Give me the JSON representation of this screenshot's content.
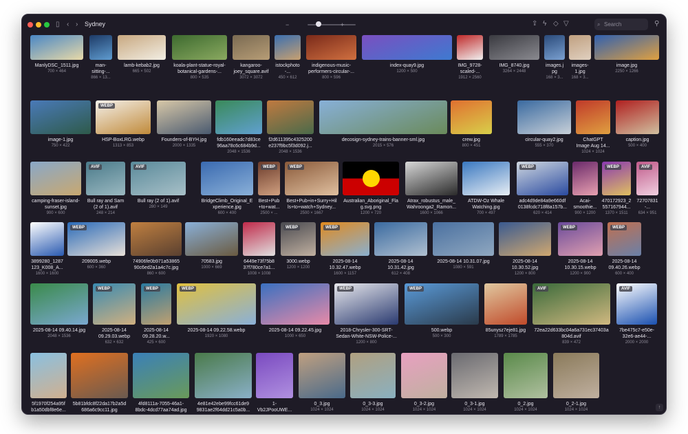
{
  "window": {
    "title": "Sydney",
    "search_placeholder": "Search",
    "slider_minus": "−",
    "slider_plus": "+"
  },
  "colors": {
    "close": "#ff5f57",
    "minimize": "#febc2e",
    "zoom": "#28c840"
  },
  "rows": [
    [
      {
        "name": "ManlyDSC_1511.jpg",
        "dims": "700 × 464",
        "badge": "",
        "colors": [
          "#4a87c5",
          "#e8d9a8"
        ]
      },
      {
        "name": "man-\nsitting-...",
        "dims": "866 × 13...",
        "badge": "",
        "colors": [
          "#1d3a66",
          "#5f9cd0"
        ]
      },
      {
        "name": "lamb-kebab2.jpg",
        "dims": "665 × 502",
        "badge": "",
        "colors": [
          "#c8a880",
          "#f2eee4"
        ]
      },
      {
        "name": "koala-plant-statue-royal-\nbotanical-gardens-...",
        "dims": "800 × 535",
        "badge": "",
        "colors": [
          "#3d6a2f",
          "#8aa960"
        ]
      },
      {
        "name": "kangaroo-\njoey_square.avif",
        "dims": "3072 × 3072",
        "badge": "",
        "colors": [
          "#7a6a52",
          "#b79d76"
        ]
      },
      {
        "name": "istockphoto\n-...",
        "dims": "450 × 612",
        "badge": "",
        "colors": [
          "#3b6fb0",
          "#c8a070"
        ]
      },
      {
        "name": "indigenous-music-\nperformers-circular-...",
        "dims": "800 × 596",
        "badge": "",
        "colors": [
          "#7a2a1a",
          "#d07040"
        ]
      },
      {
        "name": "index-quay9.jpg",
        "dims": "1200 × 500",
        "badge": "",
        "colors": [
          "#7a4fc0",
          "#3e7ad0"
        ]
      },
      {
        "name": "IMG_9728-\nscaled-...",
        "dims": "1912 × 2560",
        "badge": "",
        "colors": [
          "#c02a2a",
          "#f0f0f0"
        ]
      },
      {
        "name": "IMG_8740.jpg",
        "dims": "3264 × 2448",
        "badge": "",
        "colors": [
          "#3a3a40",
          "#8a8a90"
        ]
      },
      {
        "name": "images.j\npg",
        "dims": "168 × 3...",
        "badge": "",
        "colors": [
          "#2a4a7a",
          "#7aa0d0"
        ]
      },
      {
        "name": "images-\n1.jpg",
        "dims": "168 × 3...",
        "badge": "",
        "colors": [
          "#c0a080",
          "#e0d0c0"
        ]
      },
      {
        "name": "image.jpg",
        "dims": "2250 × 1266",
        "badge": "",
        "colors": [
          "#3060b0",
          "#e0a040"
        ]
      }
    ],
    [
      {
        "name": "image-1.jpg",
        "dims": "750 × 422",
        "badge": "",
        "colors": [
          "#4a7ab8",
          "#2e5a4a"
        ]
      },
      {
        "name": "HSP-BoxLRG.webp",
        "dims": "1313 × 853",
        "badge": "WEBP",
        "colors": [
          "#f4f0ea",
          "#c08a3a"
        ]
      },
      {
        "name": "Founders-of-BYH.jpg",
        "dims": "2000 × 1335",
        "badge": "",
        "colors": [
          "#d8c8a8",
          "#4a5a70"
        ]
      },
      {
        "name": "fdb160eeadc7d83ce\n96aa78c6c684b9d...",
        "dims": "2048 × 1536",
        "badge": "",
        "colors": [
          "#3a8a5a",
          "#60a0d0"
        ]
      },
      {
        "name": "f2d611395c4325200\ne237f9bc5f3d092.j...",
        "dims": "2048 × 1536",
        "badge": "",
        "colors": [
          "#c07a40",
          "#4a6a4a"
        ]
      },
      {
        "name": "decosign-sydney-trains-banner-sml.jpg",
        "dims": "2015 × 576",
        "badge": "",
        "colors": [
          "#88b0d8",
          "#6a8a5a"
        ]
      },
      {
        "name": "crew.jpg",
        "dims": "800 × 451",
        "badge": "",
        "colors": [
          "#e07030",
          "#d8d04a"
        ]
      },
      {
        "name": "circular-quay2.jpg",
        "dims": "555 × 370",
        "badge": "",
        "colors": [
          "#3a6aa0",
          "#c8d0d8"
        ]
      },
      {
        "name": "ChatGPT\nImage Aug 14...",
        "dims": "1024 × 1024",
        "badge": "",
        "colors": [
          "#c03a2a",
          "#e0a040"
        ]
      },
      {
        "name": "caption.jpg",
        "dims": "500 × 400",
        "badge": "",
        "colors": [
          "#b02020",
          "#d0c0a0"
        ]
      }
    ],
    [
      {
        "name": "camping-fraser-island-\nsunset.jpg",
        "dims": "900 × 600",
        "badge": "",
        "colors": [
          "#8aa8c8",
          "#c8a870"
        ]
      },
      {
        "name": "Bull ray and Sam\n(2 of 1).avif",
        "dims": "248 × 214",
        "badge": "AVIF",
        "colors": [
          "#4a7a8a",
          "#9ab8c0"
        ]
      },
      {
        "name": "Bull ray (2 of 1).avif",
        "dims": "280 × 149",
        "badge": "AVIF",
        "colors": [
          "#5a8a9a",
          "#a8c0c8"
        ]
      },
      {
        "name": "BridgeClimb_Original_E\nxperience.jpg",
        "dims": "600 × 400",
        "badge": "",
        "colors": [
          "#3a6ab0",
          "#8ab0d8"
        ]
      },
      {
        "name": "Best+Pub\n+to+wat...",
        "dims": "2500 × ...",
        "badge": "WEBP",
        "colors": [
          "#6a3a2a",
          "#d0a080"
        ]
      },
      {
        "name": "Best+Pub+in+Surry+Hil\nls+to+watch+Sydney...",
        "dims": "2500 × 1667",
        "badge": "WEBP",
        "colors": [
          "#8a5a3a",
          "#e0c0a0"
        ]
      },
      {
        "name": "Australian_Aboriginal_Fla\ng.svg.png",
        "dims": "1200 × 720",
        "badge": "",
        "flag": "aboriginal",
        "colors": [
          "#000000",
          "#cc0000"
        ]
      },
      {
        "name": "Atrax_robustus_male_\nWahroonga2_Ramon...",
        "dims": "1600 × 1066",
        "badge": "",
        "colors": [
          "#d8d8d8",
          "#2a2a2a"
        ]
      },
      {
        "name": "ATDW-Oz Whale\nWatching.jpg",
        "dims": "700 × 497",
        "badge": "",
        "colors": [
          "#3a78c0",
          "#e8eef4"
        ]
      },
      {
        "name": "adc4d9de84a9e660df\n0138fcdc718f8a157b...",
        "dims": "620 × 414",
        "badge": "WEBP",
        "colors": [
          "#d0d8e0",
          "#2a4aa0"
        ]
      },
      {
        "name": "Acai-\nsmoothie...",
        "dims": "900 × 1200",
        "badge": "",
        "colors": [
          "#6a2a6a",
          "#e8a0b0"
        ]
      },
      {
        "name": "470172923_2\n557167944...",
        "dims": "1370 × 1511",
        "badge": "WEBP",
        "colors": [
          "#8a3ab0",
          "#e0c060"
        ]
      },
      {
        "name": "72707831\n-...",
        "dims": "634 × 951",
        "badge": "AVIF",
        "colors": [
          "#c05a8a",
          "#f0d0e0"
        ]
      }
    ],
    [
      {
        "name": "3899280_1287\n123_K008_A...",
        "dims": "1600 × 1600",
        "badge": "",
        "colors": [
          "#ffffff",
          "#2a5ab0"
        ]
      },
      {
        "name": "209005.webp",
        "dims": "600 × 360",
        "badge": "WEBP",
        "colors": [
          "#2a6ab8",
          "#e8e0d8"
        ]
      },
      {
        "name": "74906fe0b971a53865\n90c6ed2a1a4c7c.jpg",
        "dims": "860 × 600",
        "badge": "",
        "colors": [
          "#c08040",
          "#5a4030"
        ]
      },
      {
        "name": "70583.jpg",
        "dims": "1000 × 669",
        "badge": "",
        "colors": [
          "#8ab0d8",
          "#6a5a40"
        ]
      },
      {
        "name": "6449e73f75b8\n37f780ce7a1...",
        "dims": "1008 × 1008",
        "badge": "",
        "colors": [
          "#c02a4a",
          "#e0e0e0"
        ]
      },
      {
        "name": "3000.webp",
        "dims": "1200 × 1200",
        "badge": "WEBP",
        "colors": [
          "#4a4a50",
          "#c0b0a0"
        ]
      },
      {
        "name": "2025-08-14\n10.32.47.webp",
        "dims": "1600 × 1157",
        "badge": "WEBP",
        "colors": [
          "#e08a20",
          "#8ab0d0"
        ]
      },
      {
        "name": "2025-08-14\n10.31.42.jpg",
        "dims": "612 × 408",
        "badge": "",
        "colors": [
          "#3a6aa0",
          "#b0c0d0"
        ]
      },
      {
        "name": "2025-08-14 10.31.07.jpg",
        "dims": "1080 × 591",
        "badge": "",
        "colors": [
          "#4a70a0",
          "#90a8c0"
        ]
      },
      {
        "name": "2025-08-14\n10.30.52.jpg",
        "dims": "1200 × 800",
        "badge": "",
        "colors": [
          "#3a5a90",
          "#d0a870"
        ]
      },
      {
        "name": "2025-08-14\n10.30.15.webp",
        "dims": "1200 × 900",
        "badge": "WEBP",
        "colors": [
          "#6a4a9a",
          "#e0a0b0"
        ]
      },
      {
        "name": "2025-08-14\n09.40.26.webp",
        "dims": "600 × 400",
        "badge": "WEBP",
        "colors": [
          "#c07050",
          "#6a80a8"
        ]
      }
    ],
    [
      {
        "name": "2025-08-14 09.40.14.jpg",
        "dims": "2048 × 1536",
        "badge": "",
        "colors": [
          "#3a8a4a",
          "#7aa8d0"
        ]
      },
      {
        "name": "2025-08-14\n09.29.03.webp",
        "dims": "632 × 632",
        "badge": "WEBP",
        "colors": [
          "#3a8ab0",
          "#d0b080"
        ]
      },
      {
        "name": "2025-08-14\n09.28.20.w...",
        "dims": "425 × 600",
        "badge": "WEBP",
        "colors": [
          "#2a7aa0",
          "#c0a070"
        ]
      },
      {
        "name": "2025-08-14 09.22.58.webp",
        "dims": "1920 × 1080",
        "badge": "WEBP",
        "colors": [
          "#e0c040",
          "#8ab0d8"
        ]
      },
      {
        "name": "2025-08-14 09.22.45.jpg",
        "dims": "1000 × 650",
        "badge": "",
        "colors": [
          "#3a70c0",
          "#e88aa8"
        ]
      },
      {
        "name": "2018-Chrysler-300-SRT-\nSedan-White-NSW-Police-...",
        "dims": "1200 × 800",
        "badge": "WEBP",
        "colors": [
          "#e8e8ec",
          "#2a3a70"
        ]
      },
      {
        "name": "500.webp",
        "dims": "500 × 300",
        "badge": "WEBP",
        "colors": [
          "#5a9ad8",
          "#2a3a4a"
        ]
      },
      {
        "name": "85unysz7eje81.jpg",
        "dims": "1789 × 1785",
        "badge": "",
        "colors": [
          "#e0c8a0",
          "#c04a2a"
        ]
      },
      {
        "name": "72ea22d633bc04a6a731ec37403a\n804d.avif",
        "dims": "839 × 472",
        "badge": "AVIF",
        "colors": [
          "#3a6a3a",
          "#d0b880"
        ]
      },
      {
        "name": "7be475c7-e50e-\n32e6-ae44-...",
        "dims": "2000 × 2000",
        "badge": "AVIF",
        "colors": [
          "#ffffff",
          "#1a50b0"
        ]
      }
    ],
    [
      {
        "name": "5f1970f254a95f\nb1a50dbf8e6e...",
        "dims": "1199 × 1476",
        "badge": "",
        "colors": [
          "#8ac0e0",
          "#d0b090"
        ]
      },
      {
        "name": "5b81bfdc8f22da17b2a5d\n686a6c9cc11.jpg",
        "dims": "1280 × 720",
        "badge": "",
        "colors": [
          "#e07020",
          "#6a5a50"
        ]
      },
      {
        "name": "4fd8111a-7055-46a1-\n8bdc-4dcd77aa74ad.jpg",
        "dims": "780 × 500",
        "badge": "",
        "colors": [
          "#3a80b8",
          "#6a9a5a"
        ]
      },
      {
        "name": "4e81e42ebe99fcc61de9\n9831ae2f64dd21c5a0b...",
        "dims": "960 × 639",
        "badge": "",
        "colors": [
          "#4a7a4a",
          "#8ab0c8"
        ]
      },
      {
        "name": "1-\nVb2JPooUWE...",
        "dims": "967 × 1200",
        "badge": "",
        "colors": [
          "#7a4ac0",
          "#b090e0"
        ]
      },
      {
        "name": "0_3.jpg",
        "dims": "1024 × 1024",
        "badge": "",
        "colors": [
          "#c0a080",
          "#4a6a8a"
        ]
      },
      {
        "name": "0_3-3.jpg",
        "dims": "1024 × 1024",
        "badge": "",
        "colors": [
          "#b0a080",
          "#8ab0c0"
        ]
      },
      {
        "name": "0_3-2.jpg",
        "dims": "1024 × 1024",
        "badge": "",
        "colors": [
          "#e8a0c0",
          "#c0b0a0"
        ]
      },
      {
        "name": "0_3-1.jpg",
        "dims": "1024 × 1024",
        "badge": "",
        "colors": [
          "#6a6a70",
          "#c0b8b0"
        ]
      },
      {
        "name": "0_2.jpg",
        "dims": "1024 × 1024",
        "badge": "",
        "colors": [
          "#5a8a4a",
          "#b0c0a0"
        ]
      },
      {
        "name": "0_2-1.jpg",
        "dims": "1024 × 1024",
        "badge": "",
        "colors": [
          "#8a7a5a",
          "#c0b0a0"
        ]
      }
    ]
  ]
}
